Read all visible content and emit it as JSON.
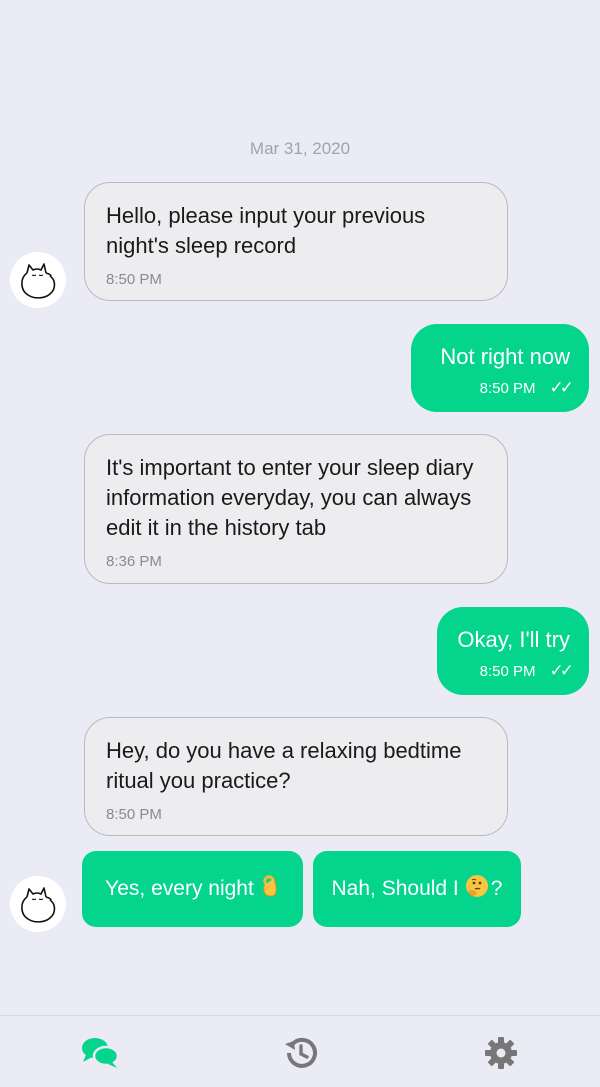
{
  "conversation": {
    "date": "Mar 31, 2020",
    "messages": [
      {
        "side": "bot",
        "text": "Hello, please input your previous night's sleep record",
        "time": "8:50 PM"
      },
      {
        "side": "user",
        "text": "Not right now",
        "time": "8:50 PM",
        "status": "✓✓"
      },
      {
        "side": "bot",
        "text": "It's important to enter your sleep diary information everyday, you can always edit it in the history tab",
        "time": "8:36 PM"
      },
      {
        "side": "user",
        "text": "Okay, I'll try",
        "time": "8:50 PM",
        "status": "✓✓"
      },
      {
        "side": "bot",
        "text": "Hey, do you have a relaxing bedtime ritual you practice?",
        "time": "8:50 PM"
      }
    ]
  },
  "quick_replies": [
    {
      "label_before": "Yes, every night",
      "emoji": "ok-hand",
      "label_after": ""
    },
    {
      "label_before": "Nah, Should I",
      "emoji": "thinking-face",
      "label_after": "?"
    }
  ],
  "tabbar": {
    "tabs": [
      {
        "icon": "chat-icon",
        "active": true
      },
      {
        "icon": "history-icon",
        "active": false
      },
      {
        "icon": "gear-icon",
        "active": false
      }
    ]
  },
  "colors": {
    "accent": "#05d48c",
    "background": "#ebebf5",
    "bot_bubble": "#ededf0",
    "inactive_icon": "#777777"
  }
}
